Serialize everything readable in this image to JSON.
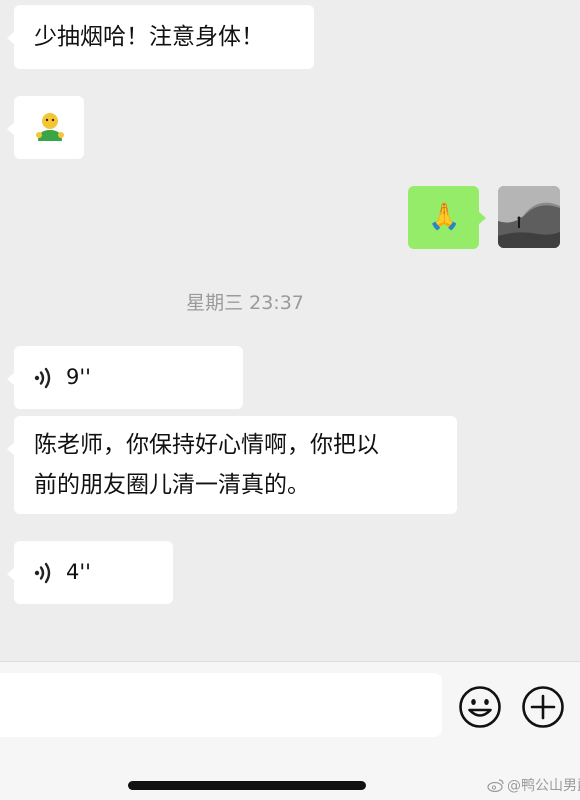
{
  "messages": {
    "m1": {
      "text": "少抽烟哈！注意身体！"
    },
    "m2": {
      "emoji": "emoji-figure-green-shirt"
    },
    "m3": {
      "emoji": "🙏"
    },
    "timestamp": "星期三 23:37",
    "voice1": {
      "duration": "9''"
    },
    "m4": {
      "line1": "陈老师，你保持好心情啊，你把以",
      "line2": "前的朋友圈儿清一清真的。"
    },
    "voice2": {
      "duration": "4''"
    }
  },
  "watermark": "@鸭公山男爵",
  "colors": {
    "background": "#ededed",
    "incoming_bubble": "#ffffff",
    "outgoing_bubble": "#95ec69",
    "timestamp": "#9a9a9a"
  }
}
